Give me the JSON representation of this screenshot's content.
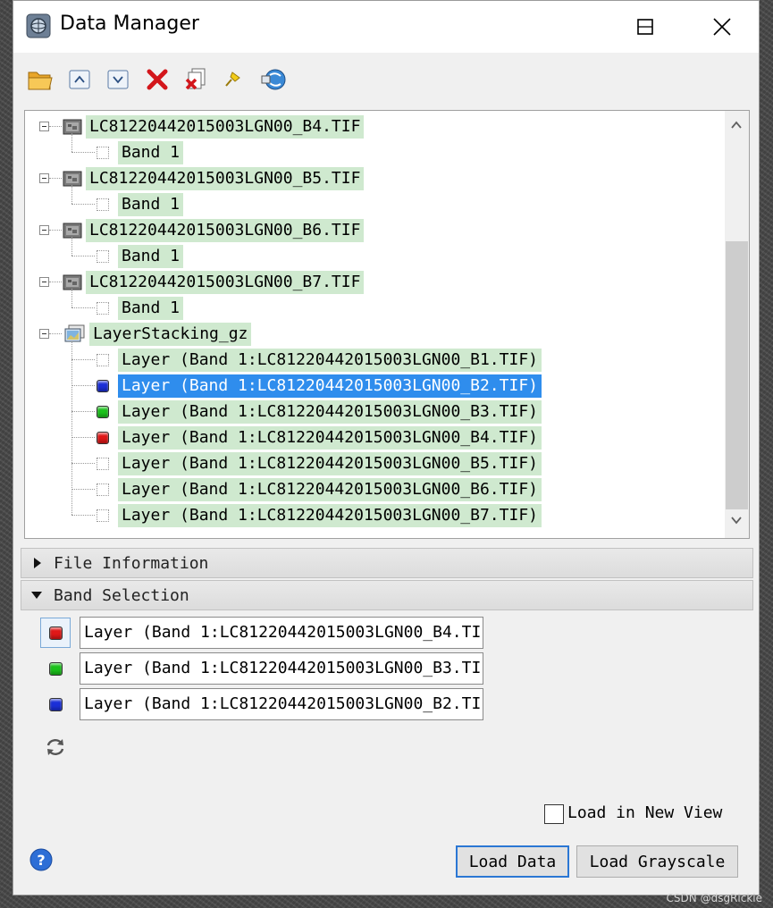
{
  "window": {
    "title": "Data Manager",
    "controls": {
      "minimize": "minimize",
      "maximize": "maximize",
      "close": "close"
    }
  },
  "toolbar": {
    "buttons": [
      {
        "icon": "open-folder-icon",
        "tooltip": ""
      },
      {
        "icon": "expand-up-icon",
        "tooltip": ""
      },
      {
        "icon": "collapse-down-icon",
        "tooltip": ""
      },
      {
        "icon": "delete-x-icon",
        "tooltip": ""
      },
      {
        "icon": "close-all-icon",
        "tooltip": ""
      },
      {
        "icon": "pin-icon",
        "tooltip": ""
      },
      {
        "icon": "sync-view-icon",
        "tooltip": ""
      }
    ]
  },
  "tree": {
    "files": [
      {
        "name": "LC81220442015003LGN00_B4.TIF",
        "bands": [
          "Band 1"
        ]
      },
      {
        "name": "LC81220442015003LGN00_B5.TIF",
        "bands": [
          "Band 1"
        ]
      },
      {
        "name": "LC81220442015003LGN00_B6.TIF",
        "bands": [
          "Band 1"
        ]
      },
      {
        "name": "LC81220442015003LGN00_B7.TIF",
        "bands": [
          "Band 1"
        ]
      }
    ],
    "stack": {
      "name": "LayerStacking_gz",
      "layers": [
        {
          "label": "Layer (Band 1:LC81220442015003LGN00_B1.TIF)",
          "color": "none"
        },
        {
          "label": "Layer (Band 1:LC81220442015003LGN00_B2.TIF)",
          "color": "blue",
          "selected": true
        },
        {
          "label": "Layer (Band 1:LC81220442015003LGN00_B3.TIF)",
          "color": "green"
        },
        {
          "label": "Layer (Band 1:LC81220442015003LGN00_B4.TIF)",
          "color": "red"
        },
        {
          "label": "Layer (Band 1:LC81220442015003LGN00_B5.TIF)",
          "color": "none"
        },
        {
          "label": "Layer (Band 1:LC81220442015003LGN00_B6.TIF)",
          "color": "none"
        },
        {
          "label": "Layer (Band 1:LC81220442015003LGN00_B7.TIF)",
          "color": "none"
        }
      ]
    }
  },
  "sections": {
    "file_information": "File Information",
    "band_selection": "Band Selection"
  },
  "band_selection": {
    "red": "Layer (Band 1:LC81220442015003LGN00_B4.TI",
    "green": "Layer (Band 1:LC81220442015003LGN00_B3.TI",
    "blue": "Layer (Band 1:LC81220442015003LGN00_B2.TI"
  },
  "footer": {
    "load_in_new_view": "Load in New View",
    "load_data": "Load Data",
    "load_grayscale": "Load Grayscale"
  },
  "watermark": "CSDN @dsgRickie",
  "colors": {
    "red": "#e01818",
    "green": "#1cc21c",
    "blue": "#1b2fd8",
    "selection": "#2f8ded",
    "row_highlight": "#cfe9cf"
  }
}
